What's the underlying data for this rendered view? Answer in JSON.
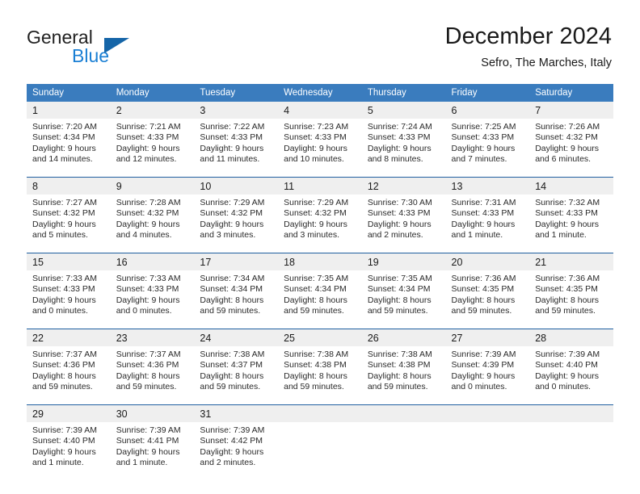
{
  "brand": {
    "name_part1": "General",
    "name_part2": "Blue",
    "logo_icon": "triangle-logo-icon",
    "accent_color": "#1a7fd4",
    "triangle_color": "#1565a8"
  },
  "header": {
    "title": "December 2024",
    "subtitle": "Sefro, The Marches, Italy"
  },
  "theme": {
    "header_row_bg": "#3a7cbe",
    "daynum_bg": "#efefef",
    "divider_color": "#1f5fa0",
    "text_color": "#1a1a1a"
  },
  "weekdays": [
    "Sunday",
    "Monday",
    "Tuesday",
    "Wednesday",
    "Thursday",
    "Friday",
    "Saturday"
  ],
  "weeks": [
    {
      "days": [
        {
          "day": "1",
          "sunrise": "Sunrise: 7:20 AM",
          "sunset": "Sunset: 4:34 PM",
          "daylight1": "Daylight: 9 hours",
          "daylight2": "and 14 minutes."
        },
        {
          "day": "2",
          "sunrise": "Sunrise: 7:21 AM",
          "sunset": "Sunset: 4:33 PM",
          "daylight1": "Daylight: 9 hours",
          "daylight2": "and 12 minutes."
        },
        {
          "day": "3",
          "sunrise": "Sunrise: 7:22 AM",
          "sunset": "Sunset: 4:33 PM",
          "daylight1": "Daylight: 9 hours",
          "daylight2": "and 11 minutes."
        },
        {
          "day": "4",
          "sunrise": "Sunrise: 7:23 AM",
          "sunset": "Sunset: 4:33 PM",
          "daylight1": "Daylight: 9 hours",
          "daylight2": "and 10 minutes."
        },
        {
          "day": "5",
          "sunrise": "Sunrise: 7:24 AM",
          "sunset": "Sunset: 4:33 PM",
          "daylight1": "Daylight: 9 hours",
          "daylight2": "and 8 minutes."
        },
        {
          "day": "6",
          "sunrise": "Sunrise: 7:25 AM",
          "sunset": "Sunset: 4:33 PM",
          "daylight1": "Daylight: 9 hours",
          "daylight2": "and 7 minutes."
        },
        {
          "day": "7",
          "sunrise": "Sunrise: 7:26 AM",
          "sunset": "Sunset: 4:32 PM",
          "daylight1": "Daylight: 9 hours",
          "daylight2": "and 6 minutes."
        }
      ]
    },
    {
      "days": [
        {
          "day": "8",
          "sunrise": "Sunrise: 7:27 AM",
          "sunset": "Sunset: 4:32 PM",
          "daylight1": "Daylight: 9 hours",
          "daylight2": "and 5 minutes."
        },
        {
          "day": "9",
          "sunrise": "Sunrise: 7:28 AM",
          "sunset": "Sunset: 4:32 PM",
          "daylight1": "Daylight: 9 hours",
          "daylight2": "and 4 minutes."
        },
        {
          "day": "10",
          "sunrise": "Sunrise: 7:29 AM",
          "sunset": "Sunset: 4:32 PM",
          "daylight1": "Daylight: 9 hours",
          "daylight2": "and 3 minutes."
        },
        {
          "day": "11",
          "sunrise": "Sunrise: 7:29 AM",
          "sunset": "Sunset: 4:32 PM",
          "daylight1": "Daylight: 9 hours",
          "daylight2": "and 3 minutes."
        },
        {
          "day": "12",
          "sunrise": "Sunrise: 7:30 AM",
          "sunset": "Sunset: 4:33 PM",
          "daylight1": "Daylight: 9 hours",
          "daylight2": "and 2 minutes."
        },
        {
          "day": "13",
          "sunrise": "Sunrise: 7:31 AM",
          "sunset": "Sunset: 4:33 PM",
          "daylight1": "Daylight: 9 hours",
          "daylight2": "and 1 minute."
        },
        {
          "day": "14",
          "sunrise": "Sunrise: 7:32 AM",
          "sunset": "Sunset: 4:33 PM",
          "daylight1": "Daylight: 9 hours",
          "daylight2": "and 1 minute."
        }
      ]
    },
    {
      "days": [
        {
          "day": "15",
          "sunrise": "Sunrise: 7:33 AM",
          "sunset": "Sunset: 4:33 PM",
          "daylight1": "Daylight: 9 hours",
          "daylight2": "and 0 minutes."
        },
        {
          "day": "16",
          "sunrise": "Sunrise: 7:33 AM",
          "sunset": "Sunset: 4:33 PM",
          "daylight1": "Daylight: 9 hours",
          "daylight2": "and 0 minutes."
        },
        {
          "day": "17",
          "sunrise": "Sunrise: 7:34 AM",
          "sunset": "Sunset: 4:34 PM",
          "daylight1": "Daylight: 8 hours",
          "daylight2": "and 59 minutes."
        },
        {
          "day": "18",
          "sunrise": "Sunrise: 7:35 AM",
          "sunset": "Sunset: 4:34 PM",
          "daylight1": "Daylight: 8 hours",
          "daylight2": "and 59 minutes."
        },
        {
          "day": "19",
          "sunrise": "Sunrise: 7:35 AM",
          "sunset": "Sunset: 4:34 PM",
          "daylight1": "Daylight: 8 hours",
          "daylight2": "and 59 minutes."
        },
        {
          "day": "20",
          "sunrise": "Sunrise: 7:36 AM",
          "sunset": "Sunset: 4:35 PM",
          "daylight1": "Daylight: 8 hours",
          "daylight2": "and 59 minutes."
        },
        {
          "day": "21",
          "sunrise": "Sunrise: 7:36 AM",
          "sunset": "Sunset: 4:35 PM",
          "daylight1": "Daylight: 8 hours",
          "daylight2": "and 59 minutes."
        }
      ]
    },
    {
      "days": [
        {
          "day": "22",
          "sunrise": "Sunrise: 7:37 AM",
          "sunset": "Sunset: 4:36 PM",
          "daylight1": "Daylight: 8 hours",
          "daylight2": "and 59 minutes."
        },
        {
          "day": "23",
          "sunrise": "Sunrise: 7:37 AM",
          "sunset": "Sunset: 4:36 PM",
          "daylight1": "Daylight: 8 hours",
          "daylight2": "and 59 minutes."
        },
        {
          "day": "24",
          "sunrise": "Sunrise: 7:38 AM",
          "sunset": "Sunset: 4:37 PM",
          "daylight1": "Daylight: 8 hours",
          "daylight2": "and 59 minutes."
        },
        {
          "day": "25",
          "sunrise": "Sunrise: 7:38 AM",
          "sunset": "Sunset: 4:38 PM",
          "daylight1": "Daylight: 8 hours",
          "daylight2": "and 59 minutes."
        },
        {
          "day": "26",
          "sunrise": "Sunrise: 7:38 AM",
          "sunset": "Sunset: 4:38 PM",
          "daylight1": "Daylight: 8 hours",
          "daylight2": "and 59 minutes."
        },
        {
          "day": "27",
          "sunrise": "Sunrise: 7:39 AM",
          "sunset": "Sunset: 4:39 PM",
          "daylight1": "Daylight: 9 hours",
          "daylight2": "and 0 minutes."
        },
        {
          "day": "28",
          "sunrise": "Sunrise: 7:39 AM",
          "sunset": "Sunset: 4:40 PM",
          "daylight1": "Daylight: 9 hours",
          "daylight2": "and 0 minutes."
        }
      ]
    },
    {
      "days": [
        {
          "day": "29",
          "sunrise": "Sunrise: 7:39 AM",
          "sunset": "Sunset: 4:40 PM",
          "daylight1": "Daylight: 9 hours",
          "daylight2": "and 1 minute."
        },
        {
          "day": "30",
          "sunrise": "Sunrise: 7:39 AM",
          "sunset": "Sunset: 4:41 PM",
          "daylight1": "Daylight: 9 hours",
          "daylight2": "and 1 minute."
        },
        {
          "day": "31",
          "sunrise": "Sunrise: 7:39 AM",
          "sunset": "Sunset: 4:42 PM",
          "daylight1": "Daylight: 9 hours",
          "daylight2": "and 2 minutes."
        },
        {
          "day": "",
          "sunrise": "",
          "sunset": "",
          "daylight1": "",
          "daylight2": ""
        },
        {
          "day": "",
          "sunrise": "",
          "sunset": "",
          "daylight1": "",
          "daylight2": ""
        },
        {
          "day": "",
          "sunrise": "",
          "sunset": "",
          "daylight1": "",
          "daylight2": ""
        },
        {
          "day": "",
          "sunrise": "",
          "sunset": "",
          "daylight1": "",
          "daylight2": ""
        }
      ]
    }
  ]
}
